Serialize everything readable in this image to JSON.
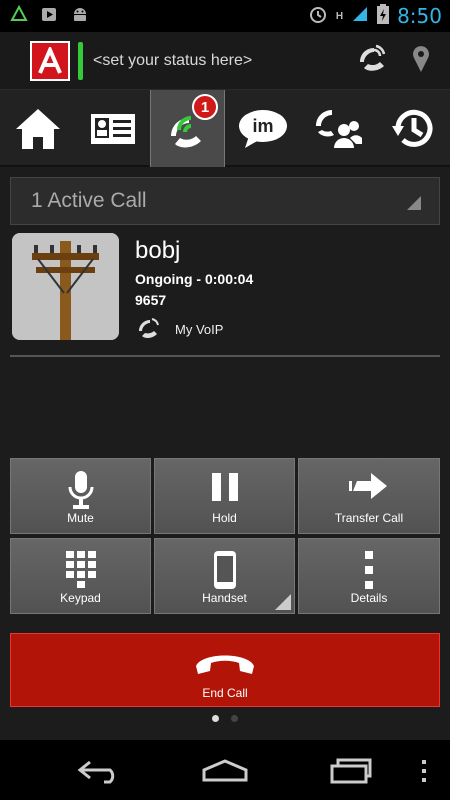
{
  "status_bar": {
    "time": "8:50",
    "network": "H"
  },
  "header": {
    "status_placeholder": "<set your status here>"
  },
  "tabs": [
    {
      "name": "home",
      "badge": ""
    },
    {
      "name": "contacts",
      "badge": ""
    },
    {
      "name": "calls",
      "badge": "1"
    },
    {
      "name": "im",
      "label": "im",
      "badge": ""
    },
    {
      "name": "conference",
      "badge": ""
    },
    {
      "name": "history",
      "badge": ""
    }
  ],
  "call": {
    "active_calls": "1 Active Call",
    "name": "bobj",
    "state": "Ongoing - 0:00:04",
    "number": "9657",
    "account": "My VoIP"
  },
  "controls": {
    "mute": "Mute",
    "hold": "Hold",
    "transfer": "Transfer Call",
    "keypad": "Keypad",
    "handset": "Handset",
    "details": "Details",
    "end_call": "End Call"
  },
  "colors": {
    "accent": "#33b5e5",
    "brand_red": "#d2151c",
    "end_call": "#b21407",
    "presence": "#35c93b"
  }
}
